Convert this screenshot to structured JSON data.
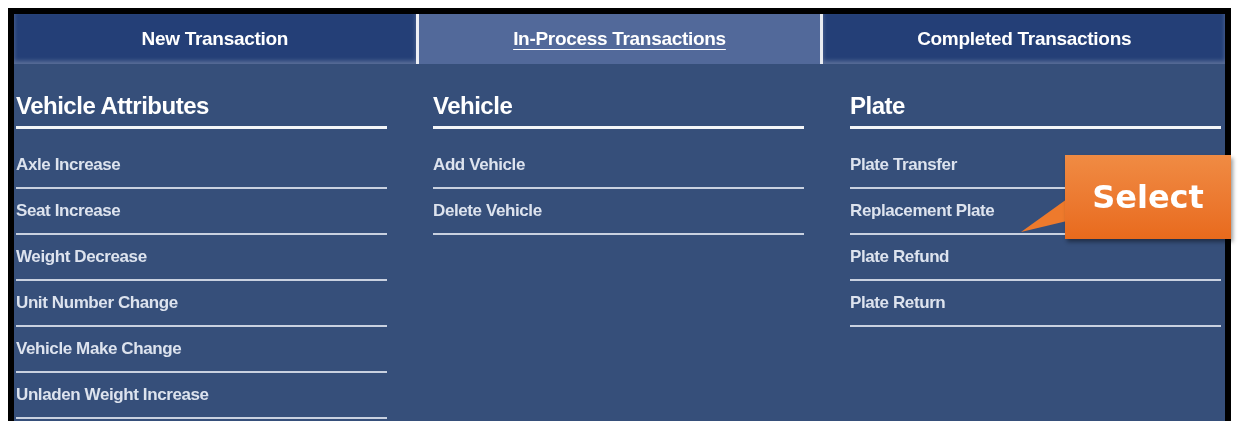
{
  "tabs": [
    {
      "label": "New Transaction",
      "selected": false
    },
    {
      "label": "In-Process Transactions",
      "selected": true
    },
    {
      "label": "Completed Transactions",
      "selected": false
    }
  ],
  "sections": [
    {
      "title": "Vehicle Attributes",
      "items": [
        "Axle Increase",
        "Seat Increase",
        "Weight Decrease",
        "Unit Number Change",
        "Vehicle Make Change",
        "Unladen Weight Increase"
      ]
    },
    {
      "title": "Vehicle",
      "items": [
        "Add Vehicle",
        "Delete Vehicle"
      ]
    },
    {
      "title": "Plate",
      "items": [
        "Plate Transfer",
        "Replacement Plate",
        "Plate Refund",
        "Plate Return"
      ]
    }
  ],
  "callout": {
    "text": "Select"
  }
}
